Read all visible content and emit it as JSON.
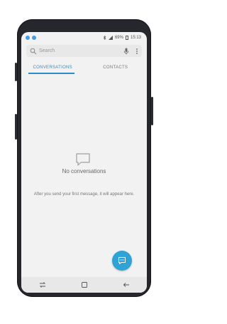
{
  "status": {
    "battery": "69%",
    "time": "15:13"
  },
  "search": {
    "placeholder": "Search"
  },
  "tabs": [
    {
      "label": "CONVERSATIONS",
      "active": true
    },
    {
      "label": "CONTACTS",
      "active": false
    }
  ],
  "empty_state": {
    "title": "No conversations",
    "subtitle": "After you send your first message, it will appear here."
  },
  "colors": {
    "accent": "#2f8ec8",
    "fab": "#2fa3d6",
    "screen_bg": "#f2f2f2"
  },
  "icons": {
    "fab": "chat-bubble-icon",
    "nav": [
      "recents-icon",
      "home-icon",
      "back-icon"
    ]
  }
}
